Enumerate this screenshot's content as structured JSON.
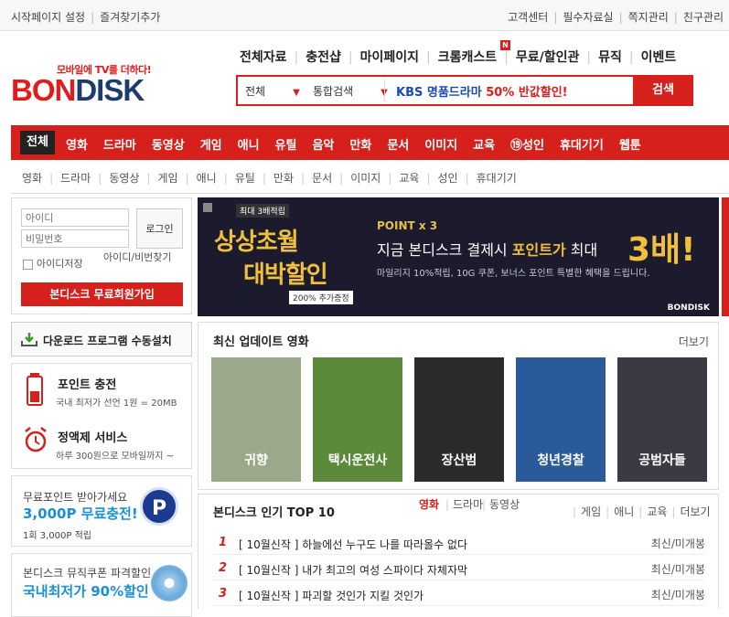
{
  "topbar": {
    "left": [
      "시작페이지 설정",
      "즐겨찾기추가"
    ],
    "right": [
      "고객센터",
      "필수자료실",
      "쪽지관리",
      "친구관리"
    ]
  },
  "logo": {
    "tagline": "모바일에 TV를 더하다!",
    "part1": "BON",
    "part2": "DISK"
  },
  "mainnav": [
    "전체자료",
    "충전샵",
    "마이페이지",
    "크롬캐스트",
    "무료/할인관",
    "뮤직",
    "이벤트"
  ],
  "new_badge": "N",
  "search": {
    "select1": "전체",
    "select2": "통합검색",
    "promo_blue": "KBS 명품드라마 ",
    "promo_red": "50% 반값할인!",
    "button": "검색"
  },
  "categories": {
    "all": "전체",
    "items": [
      "영화",
      "드라마",
      "동영상",
      "게임",
      "애니",
      "유틸",
      "음악",
      "만화",
      "문서",
      "이미지",
      "교육",
      "⑲성인",
      "휴대기기",
      "웹툰"
    ]
  },
  "subcategories": [
    "영화",
    "드라마",
    "동영상",
    "게임",
    "애니",
    "유틸",
    "만화",
    "문서",
    "이미지",
    "교육",
    "성인",
    "휴대기기"
  ],
  "login": {
    "id_placeholder": "아이디",
    "pw_placeholder": "비밀번호",
    "login_button": "로그인",
    "save_id": "아이디저장",
    "find": "아이디/비번찾기",
    "join": "본디스크 무료회원가입"
  },
  "download": {
    "label": "다운로드 프로그램 수동설치"
  },
  "point": {
    "title": "포인트 충전",
    "sub": "국내 최저가 선언 1원 = 20MB",
    "title2": "정액제 서비스",
    "sub2": "하루 300원으로 모바일까지 ~"
  },
  "free_point": {
    "line1": "무료포인트 받아가세요",
    "line2": "3,000P 무료충전!",
    "line3": "1회 3,000P 적립",
    "coin": "P"
  },
  "music": {
    "line1": "본디스크 뮤직쿠폰 파격할인",
    "line2": "국내최저가 90%할인"
  },
  "banner": {
    "badge_top": "최대 3배적립",
    "line1": "상상초월",
    "line2": "대박할인",
    "badge_bottom": "200% 추가증정",
    "point": "POINT x 3",
    "main_text": "지금 본디스크 결제시 ",
    "main_highlight": "포인트가",
    "main_suffix": " 최대",
    "big": "3배!",
    "sub": "마일리지 10%적립, 10G 쿠폰, 보너스 포인트 특별한 혜택을 드립니다.",
    "brand": "BONDISK"
  },
  "movies": {
    "title": "최신 업데이트 영화",
    "more": "더보기",
    "posters": [
      {
        "title": "귀향",
        "color": "#9aa98a"
      },
      {
        "title": "택시운전사",
        "color": "#5a8a3a"
      },
      {
        "title": "장산범",
        "color": "#2b2b2b"
      },
      {
        "title": "청년경찰",
        "color": "#2a5a9a"
      },
      {
        "title": "공범자들",
        "color": "#3a3a44"
      }
    ]
  },
  "top10": {
    "title": "본디스크 인기 TOP 10",
    "tabs": [
      "영화",
      "드라마",
      "동영상"
    ],
    "tabs2": [
      "게임",
      "애니",
      "교육"
    ],
    "more": "더보기",
    "items": [
      {
        "rank": "1",
        "title": "[ 10월신작 ] 하늘에선 누구도 나를 따라올수 없다",
        "tag": "최신/미개봉"
      },
      {
        "rank": "2",
        "title": "[ 10월신작 ] 내가 최고의 여성 스파이다 자체자막",
        "tag": "최신/미개봉"
      },
      {
        "rank": "3",
        "title": "[ 10월신작 ] 파괴할 것인가 지킬 것인가",
        "tag": "최신/미개봉"
      }
    ]
  },
  "colors": {
    "brand_red": "#d6201c",
    "brand_blue": "#1c3b6e",
    "accent_blue": "#1a8fd8"
  }
}
